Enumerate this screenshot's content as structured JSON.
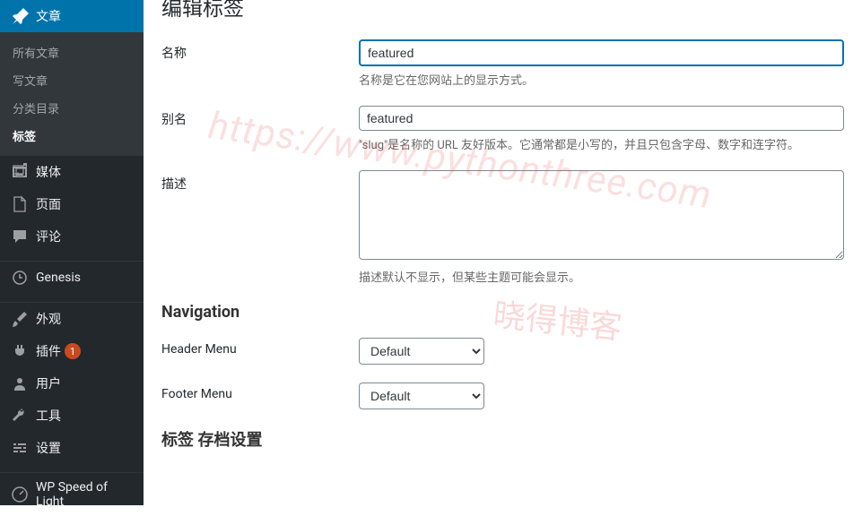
{
  "sidebar": {
    "posts": {
      "label": "文章",
      "submenu": [
        "所有文章",
        "写文章",
        "分类目录",
        "标签"
      ]
    },
    "media": "媒体",
    "pages": "页面",
    "comments": "评论",
    "genesis": "Genesis",
    "appearance": "外观",
    "plugins": "插件",
    "plugins_badge": "1",
    "users": "用户",
    "tools": "工具",
    "settings": "设置",
    "wpsol": "WP Speed of Light"
  },
  "page_title_partial": "编辑标签",
  "form": {
    "name": {
      "label": "名称",
      "value": "featured",
      "help": "名称是它在您网站上的显示方式。"
    },
    "slug": {
      "label": "别名",
      "value": "featured",
      "help": "\"slug\"是名称的 URL 友好版本。它通常都是小写的，并且只包含字母、数字和连字符。"
    },
    "description": {
      "label": "描述",
      "value": "",
      "help": "描述默认不显示，但某些主题可能会显示。"
    }
  },
  "navigation": {
    "heading": "Navigation",
    "header_menu": {
      "label": "Header Menu",
      "value": "Default"
    },
    "footer_menu": {
      "label": "Footer Menu",
      "value": "Default"
    }
  },
  "archive_heading": "标签 存档设置",
  "watermark_url": "https://www.pythonthree.com",
  "watermark_text": "晓得博客"
}
